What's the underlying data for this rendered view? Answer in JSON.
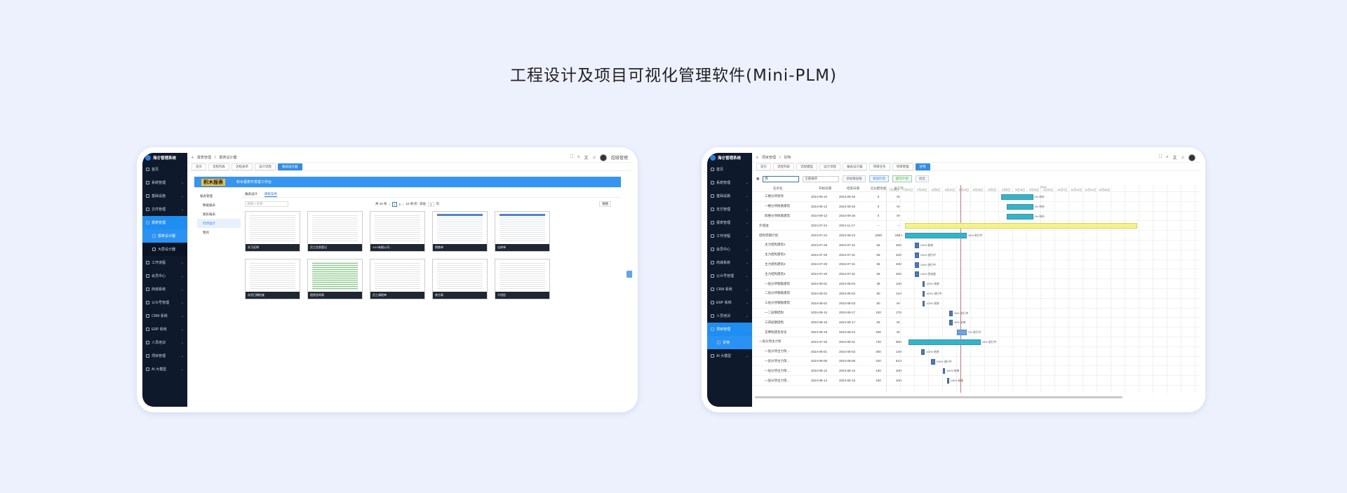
{
  "headline": "工程设计及项目可视化管理软件(Mini-PLM)",
  "left": {
    "app_title": "海仑管理系统",
    "sidebar": [
      {
        "label": "首页"
      },
      {
        "label": "系统管理"
      },
      {
        "label": "基础设施"
      },
      {
        "label": "文件管理"
      },
      {
        "label": "报表管理",
        "active": true
      },
      {
        "label": "报表设计器",
        "sub": true,
        "active": true
      },
      {
        "label": "大屏设计器",
        "sub": true
      },
      {
        "label": "工作流程"
      },
      {
        "label": "会员中心"
      },
      {
        "label": "商城系统"
      },
      {
        "label": "公众号管理"
      },
      {
        "label": "CRM 系统"
      },
      {
        "label": "ERP 系统"
      },
      {
        "label": "人员培训"
      },
      {
        "label": "项目管理"
      },
      {
        "label": "AI 大模型"
      }
    ],
    "breadcrumb": [
      "报表管理",
      "报表设计器"
    ],
    "user": "超级管理",
    "tabs": [
      "首页",
      "流程列表",
      "流程表单",
      "设计流程",
      "报表设计器"
    ],
    "banner": {
      "brand": "积木报表",
      "subtitle": "积木报表开发者工作台"
    },
    "tree": [
      "报表管理",
      "数据报表",
      "图形报表",
      "打印设计",
      "我的"
    ],
    "tree_selected": 3,
    "content_tabs": [
      "报表设计",
      "模版案例"
    ],
    "search_placeholder": "请输入名称",
    "pager": {
      "total_text": "共 10 条",
      "pages": [
        "1",
        "2"
      ],
      "per_page": "10 条/页",
      "jump_label": "前往",
      "jump_value": "1",
      "page_suffix": "页"
    },
    "view_label": "视图",
    "cards": [
      "实习证明",
      "员工信息登记",
      "XXX有限公司...",
      "销售单",
      "出库单",
      "存货日期检查",
      "租赁合同表",
      "员工请假单",
      "收方表",
      "介绍信"
    ]
  },
  "right": {
    "app_title": "海仑管理系统",
    "sidebar": [
      {
        "label": "首页"
      },
      {
        "label": "系统管理"
      },
      {
        "label": "基础设施"
      },
      {
        "label": "支付管理"
      },
      {
        "label": "报表管理"
      },
      {
        "label": "工作流程"
      },
      {
        "label": "会员中心"
      },
      {
        "label": "商城系统"
      },
      {
        "label": "公众号管理"
      },
      {
        "label": "CRM 系统"
      },
      {
        "label": "ERP 系统"
      },
      {
        "label": "人员培训"
      },
      {
        "label": "项目管理",
        "active": true
      },
      {
        "label": "甘特",
        "sub": true,
        "active": true
      },
      {
        "label": "AI 大模型"
      }
    ],
    "breadcrumb": [
      "项目管理",
      "甘特"
    ],
    "tabs": [
      "首页",
      "流程列表",
      "流程模型",
      "设计流程",
      "报表设计器",
      "项目任务",
      "项目管理",
      "甘特"
    ],
    "filter": {
      "scale": "周",
      "expand": "全部展开",
      "buttons": [
        "添加根层级",
        "添加计划",
        "提交计划",
        "退出"
      ]
    },
    "columns": [
      "任务名",
      "开始日期",
      "结束日期",
      "已分配资金",
      "总工时"
    ],
    "gantt_month": "2024",
    "gantt_days": [
      "7月15日",
      "7月22日",
      "7月29日",
      "8月5日",
      "8月12日",
      "8月19日",
      "8月26日",
      "9月2日",
      "9月9日",
      "9月16日",
      "9月23日",
      "9月30日",
      "10月7日",
      "10月14日",
      "10月21日",
      "10月28日"
    ],
    "rows": [
      {
        "name": "三楼分项装饰",
        "start": "2024-09-10",
        "end": "2024-09-26",
        "paid": "0",
        "hours": "0H",
        "bar": "teal",
        "label": "0% 待办"
      },
      {
        "name": "一楼分项防腐建筑",
        "start": "2024-09-13",
        "end": "2024-09-26",
        "paid": "0",
        "hours": "0H",
        "bar": "teal",
        "label": "0% 待办"
      },
      {
        "name": "四楼分项防腐建筑",
        "start": "2024-09-13",
        "end": "2024-09-26",
        "paid": "0",
        "hours": "0H",
        "bar": "teal",
        "label": "0% 待办"
      },
      {
        "name": "外墙油",
        "start": "2024-07-24",
        "end": "2024-11-17",
        "paid": "--",
        "hours": "--",
        "bar": "yellow",
        "label": "",
        "level": 0
      },
      {
        "name": "结构完钢计划",
        "start": "2024-07-24",
        "end": "2024-08-24",
        "paid": "1050",
        "hours": "188H",
        "bar": "teal",
        "label": "94% 进行中",
        "level": 1
      },
      {
        "name": "主力结构建筑1",
        "start": "2024-07-29",
        "end": "2024-07-31",
        "paid": "65",
        "hours": "46H",
        "bar": "dark",
        "label": "100% 结束"
      },
      {
        "name": "主力结构建筑2",
        "start": "2024-07-29",
        "end": "2024-07-31",
        "paid": "65",
        "hours": "42H",
        "bar": "dark",
        "label": "100% 进行中"
      },
      {
        "name": "主力结构建筑3",
        "start": "2024-07-29",
        "end": "2024-07-31",
        "paid": "65",
        "hours": "23H",
        "bar": "dark",
        "label": "100% 进行中"
      },
      {
        "name": "主力结构建筑4",
        "start": "2024-07-29",
        "end": "2024-07-31",
        "paid": "65",
        "hours": "46H",
        "bar": "dark",
        "label": "100% 完成度"
      },
      {
        "name": "一层分项钢筋建筑",
        "start": "2024-08-02",
        "end": "2024-08-03",
        "paid": "36",
        "hours": "13H",
        "bar": "dark",
        "label": "100% 结束"
      },
      {
        "name": "二层分项钢筋建筑",
        "start": "2024-08-02",
        "end": "2024-08-03",
        "paid": "50",
        "hours": "11H",
        "bar": "dark",
        "label": "100% 进行中"
      },
      {
        "name": "三层分项钢筋建筑",
        "start": "2024-08-02",
        "end": "2024-08-03",
        "paid": "50",
        "hours": "8H",
        "bar": "dark",
        "label": "100% 结束"
      },
      {
        "name": "一二层钢结构",
        "start": "2024-08-15",
        "end": "2024-08-17",
        "paid": "100",
        "hours": "17H",
        "bar": "dark",
        "label": "90% 进行中"
      },
      {
        "name": "三四层钢结构",
        "start": "2024-08-15",
        "end": "2024-08-17",
        "paid": "65",
        "hours": "8H",
        "bar": "dark",
        "label": "90% 结束"
      },
      {
        "name": "支撑构建及优化",
        "start": "2024-08-19",
        "end": "2024-08-24",
        "paid": "400",
        "hours": "8H",
        "bar": "blue",
        "label": "0% 进行中"
      },
      {
        "name": "一层分项主力架",
        "start": "2024-07-26",
        "end": "2024-08-31",
        "paid": "740",
        "hours": "55H",
        "bar": "teal",
        "label": "94% 进行中",
        "level": 1
      },
      {
        "name": "一层分项主力架...",
        "start": "2024-08-01",
        "end": "2024-08-03",
        "paid": "300",
        "hours": "14H",
        "bar": "dark",
        "label": "100% 结束"
      },
      {
        "name": "一层分项主力架...",
        "start": "2024-08-06",
        "end": "2024-08-08",
        "paid": "240",
        "hours": "51H",
        "bar": "dark",
        "label": "100% 进行中"
      },
      {
        "name": "一层分项主力架...",
        "start": "2024-08-12",
        "end": "2024-08-13",
        "paid": "100",
        "hours": "10H",
        "bar": "dark",
        "label": "100% 结束"
      },
      {
        "name": "一层分项主力架...",
        "start": "2024-08-14",
        "end": "2024-08-15",
        "paid": "100",
        "hours": "10H",
        "bar": "dark",
        "label": "100% 结束"
      }
    ]
  }
}
